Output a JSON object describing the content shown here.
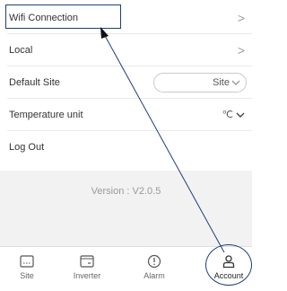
{
  "menu": {
    "wifi": {
      "label": "Wifi Connection",
      "chevron": ">"
    },
    "local": {
      "label": "Local",
      "chevron": ">"
    },
    "default_site": {
      "label": "Default Site",
      "value": "Site"
    },
    "temperature": {
      "label": "Temperature unit",
      "value": "℃"
    },
    "logout": {
      "label": "Log Out"
    }
  },
  "version": "Version : V2.0.5",
  "tabbar": [
    {
      "label": "Site",
      "icon": "site-icon"
    },
    {
      "label": "Inverter",
      "icon": "inverter-icon"
    },
    {
      "label": "Alarm",
      "icon": "alarm-icon"
    },
    {
      "label": "Account",
      "icon": "account-icon"
    }
  ],
  "colors": {
    "annotation": "#1f3d7a",
    "gray_bg": "#f2f2f2",
    "text": "#333333"
  }
}
